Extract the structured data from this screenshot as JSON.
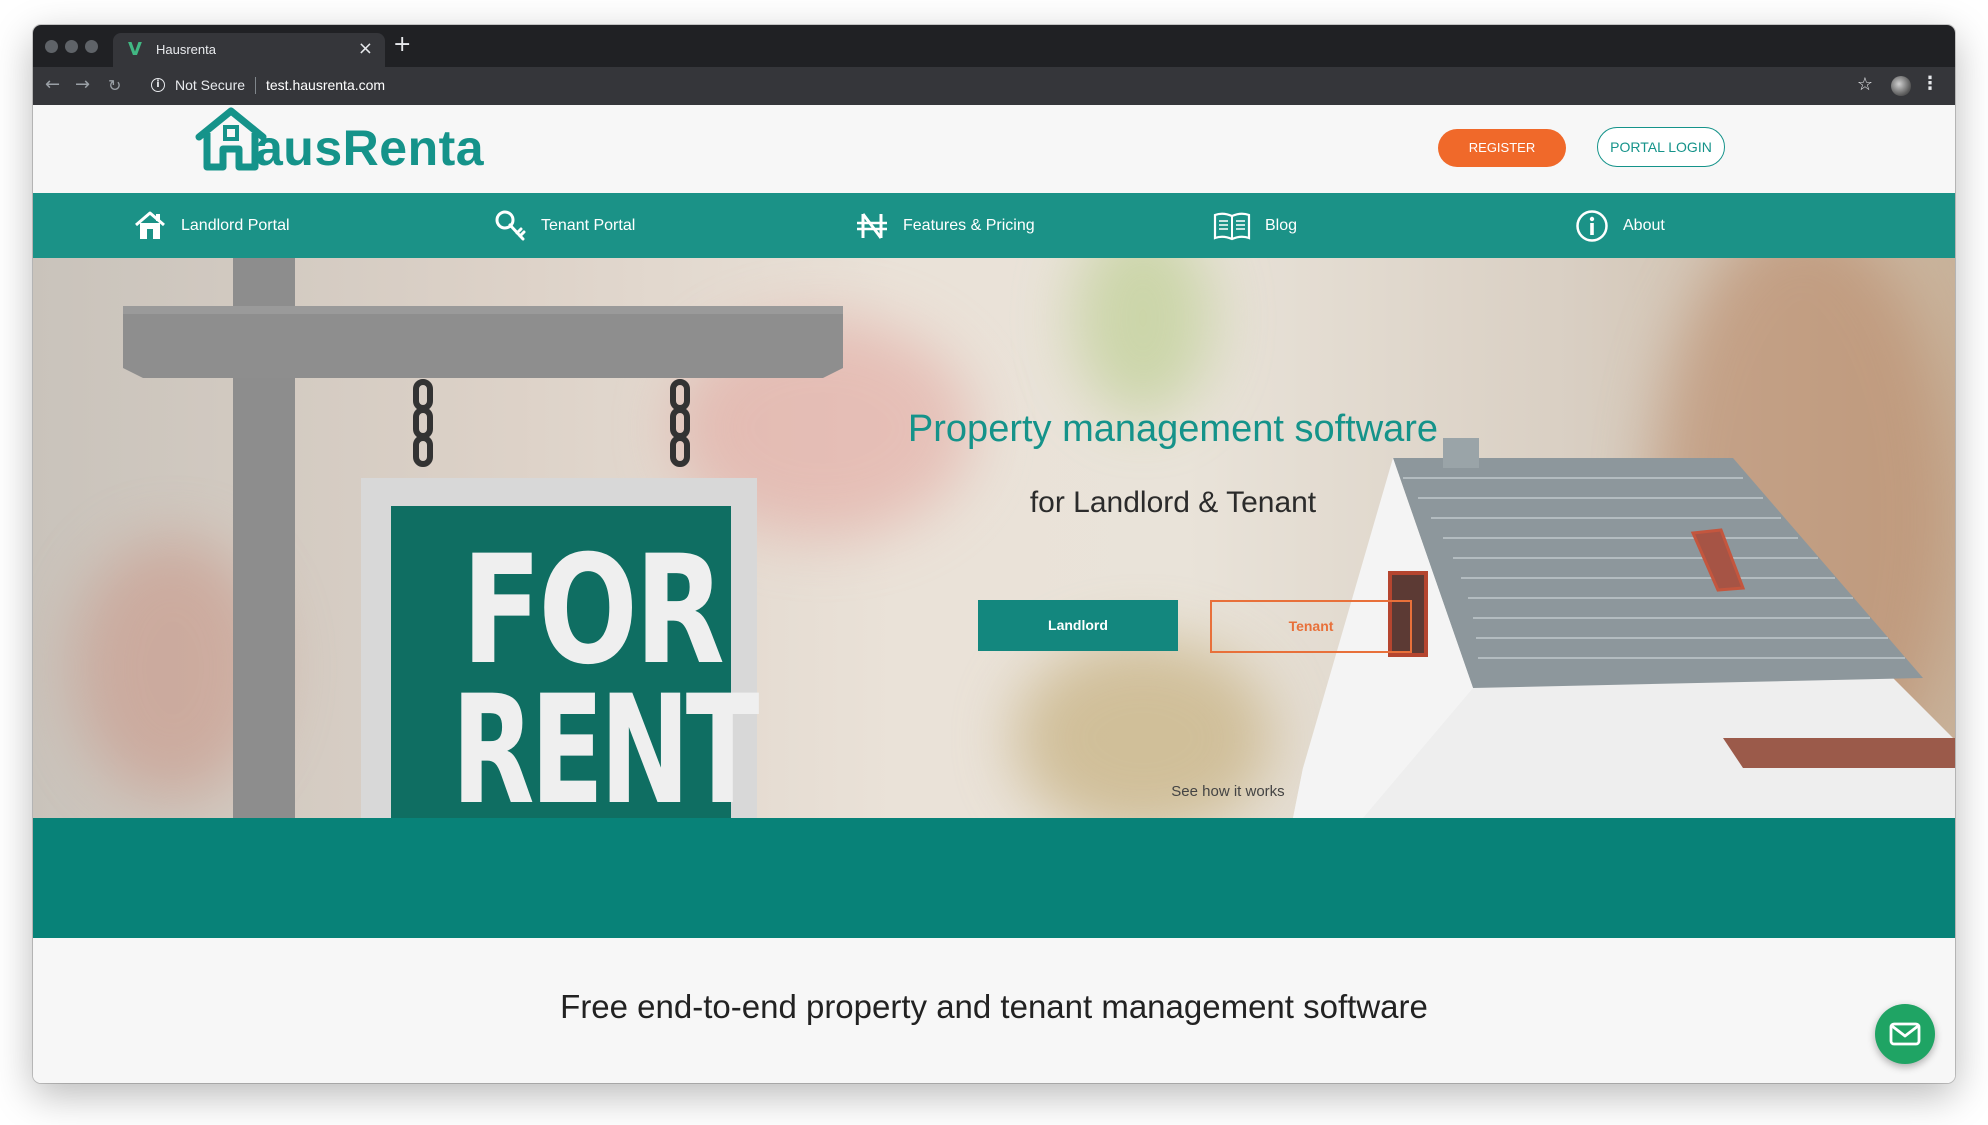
{
  "browser": {
    "tab_title": "Hausrenta",
    "tab_favicon": "V",
    "security": "Not Secure",
    "url": "test.hausrenta.com",
    "icons": [
      "back-icon",
      "forward-icon",
      "reload-icon",
      "info-icon",
      "star-icon",
      "profile-icon",
      "menu-icon",
      "close-icon",
      "new-tab-icon"
    ]
  },
  "header": {
    "logo_text": "ausRenta",
    "register_label": "REGISTER",
    "login_label": "PORTAL LOGIN"
  },
  "nav": {
    "items": [
      {
        "label": "Landlord Portal",
        "icon": "house-icon"
      },
      {
        "label": "Tenant Portal",
        "icon": "key-icon"
      },
      {
        "label": "Features & Pricing",
        "icon": "naira-icon"
      },
      {
        "label": "Blog",
        "icon": "book-icon"
      },
      {
        "label": "About",
        "icon": "info-circle-icon"
      }
    ]
  },
  "hero": {
    "title": "Property management software",
    "subtitle": "for Landlord & Tenant",
    "landlord_button": "Landlord",
    "tenant_button": "Tenant",
    "see_how": "See how it works",
    "sign_line1": "FOR",
    "sign_line2": "RENT"
  },
  "lower": {
    "title": "Free end-to-end property and tenant management software"
  },
  "colors": {
    "brand_teal": "#15938a",
    "nav_teal": "#1b9287",
    "band_teal": "#088278",
    "accent_orange": "#f0692a",
    "chat_green": "#1fa464"
  }
}
